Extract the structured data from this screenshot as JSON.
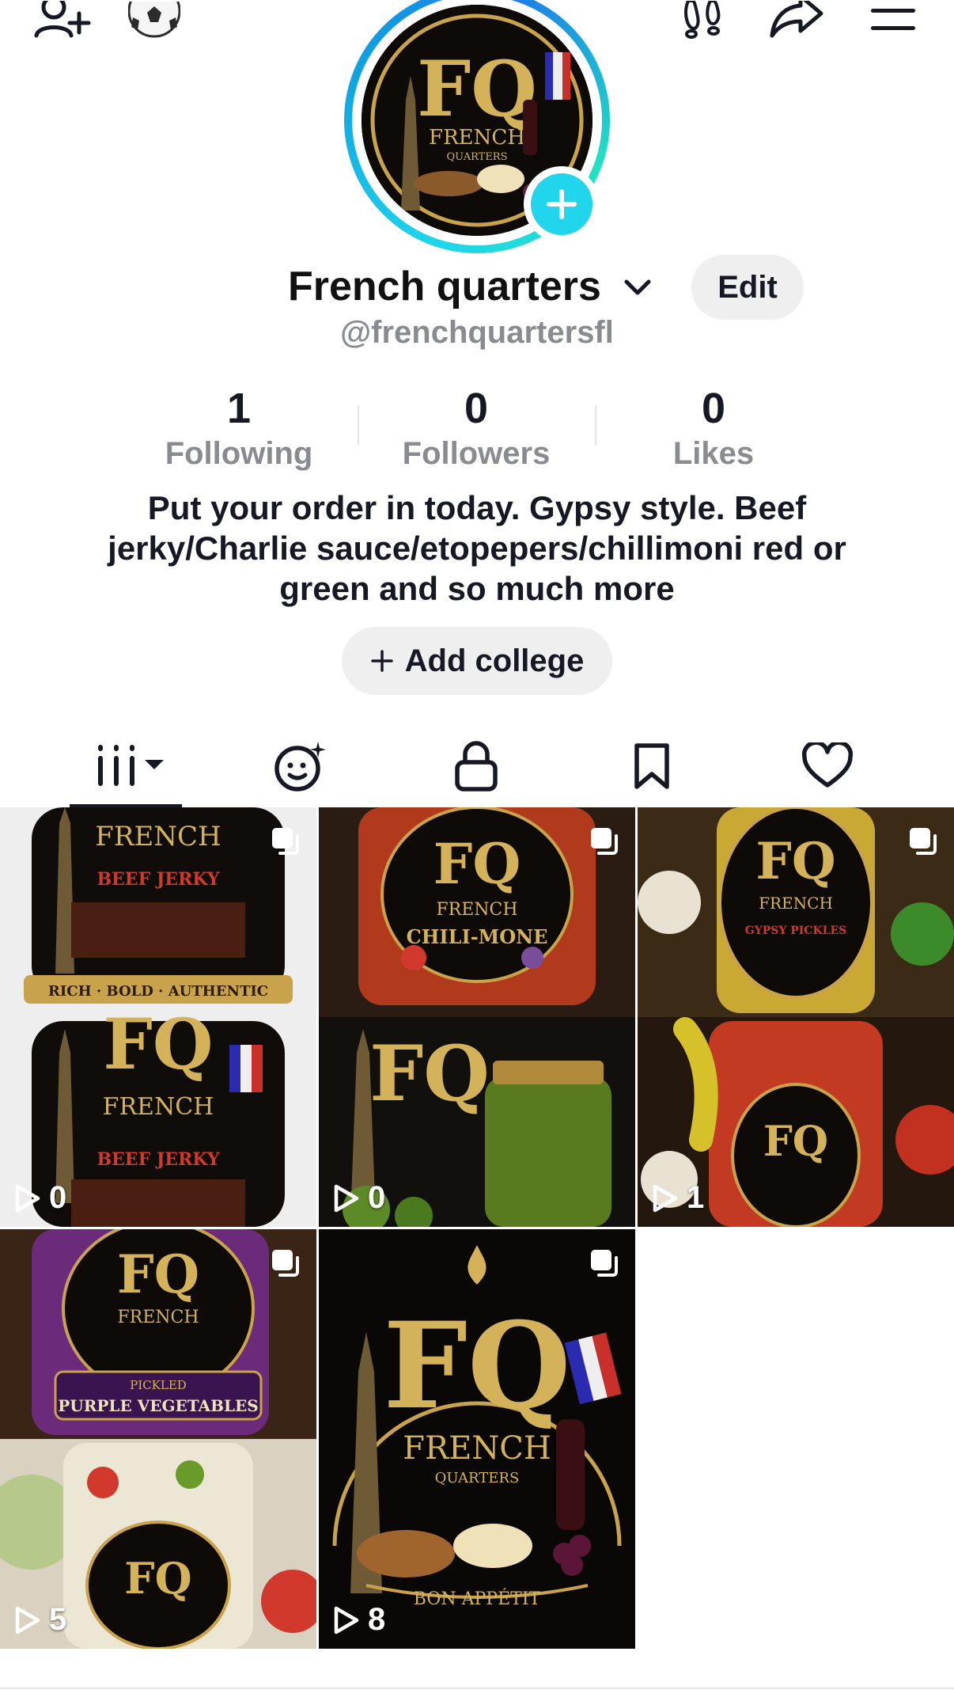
{
  "header": {
    "add_friend_icon": "person-plus-icon",
    "soccer_icon": "soccer-ball-icon",
    "footprints_icon": "footprints-icon",
    "share_icon": "share-arrow-icon",
    "menu_icon": "hamburger-menu-icon"
  },
  "profile": {
    "display_name": "French quarters",
    "handle": "@frenchquartersfl",
    "edit_label": "Edit",
    "accent_color": "#20d5ec"
  },
  "stats": [
    {
      "value": "1",
      "label": "Following"
    },
    {
      "value": "0",
      "label": "Followers"
    },
    {
      "value": "0",
      "label": "Likes"
    }
  ],
  "bio": "Put your order in today.  Gypsy style.  Beef jerky/Charlie sauce/etopepers/chillimoni red or green and so much more",
  "add_college": {
    "label": "Add college"
  },
  "tabs": [
    {
      "name": "videos-grid-icon",
      "active": true
    },
    {
      "name": "reposts-face-icon",
      "active": false
    },
    {
      "name": "private-lock-icon",
      "active": false
    },
    {
      "name": "favorites-bookmark-icon",
      "active": false
    },
    {
      "name": "liked-heart-icon",
      "active": false
    }
  ],
  "videos": [
    {
      "views": "0",
      "theme": "beef-jerky",
      "label_top": "BEEF JERKY",
      "label_mid": "RICH · BOLD · AUTHENTIC"
    },
    {
      "views": "0",
      "theme": "chili-mone",
      "label_top": "CHILI-MONE",
      "label_mid": ""
    },
    {
      "views": "1",
      "theme": "gypsy-pickles",
      "label_top": "GYPSY PICKLES",
      "label_mid": ""
    },
    {
      "views": "5",
      "theme": "purple-vegetables",
      "label_top": "PURPLE VEGETABLES",
      "label_mid": "PICKLED"
    },
    {
      "views": "8",
      "theme": "bon-appetit",
      "label_top": "BON APPÉTIT",
      "label_mid": ""
    }
  ],
  "logo": {
    "monogram": "FQ",
    "word1": "FRENCH",
    "word2": "QUARTERS",
    "tagline": "BON APPÉTIT"
  }
}
